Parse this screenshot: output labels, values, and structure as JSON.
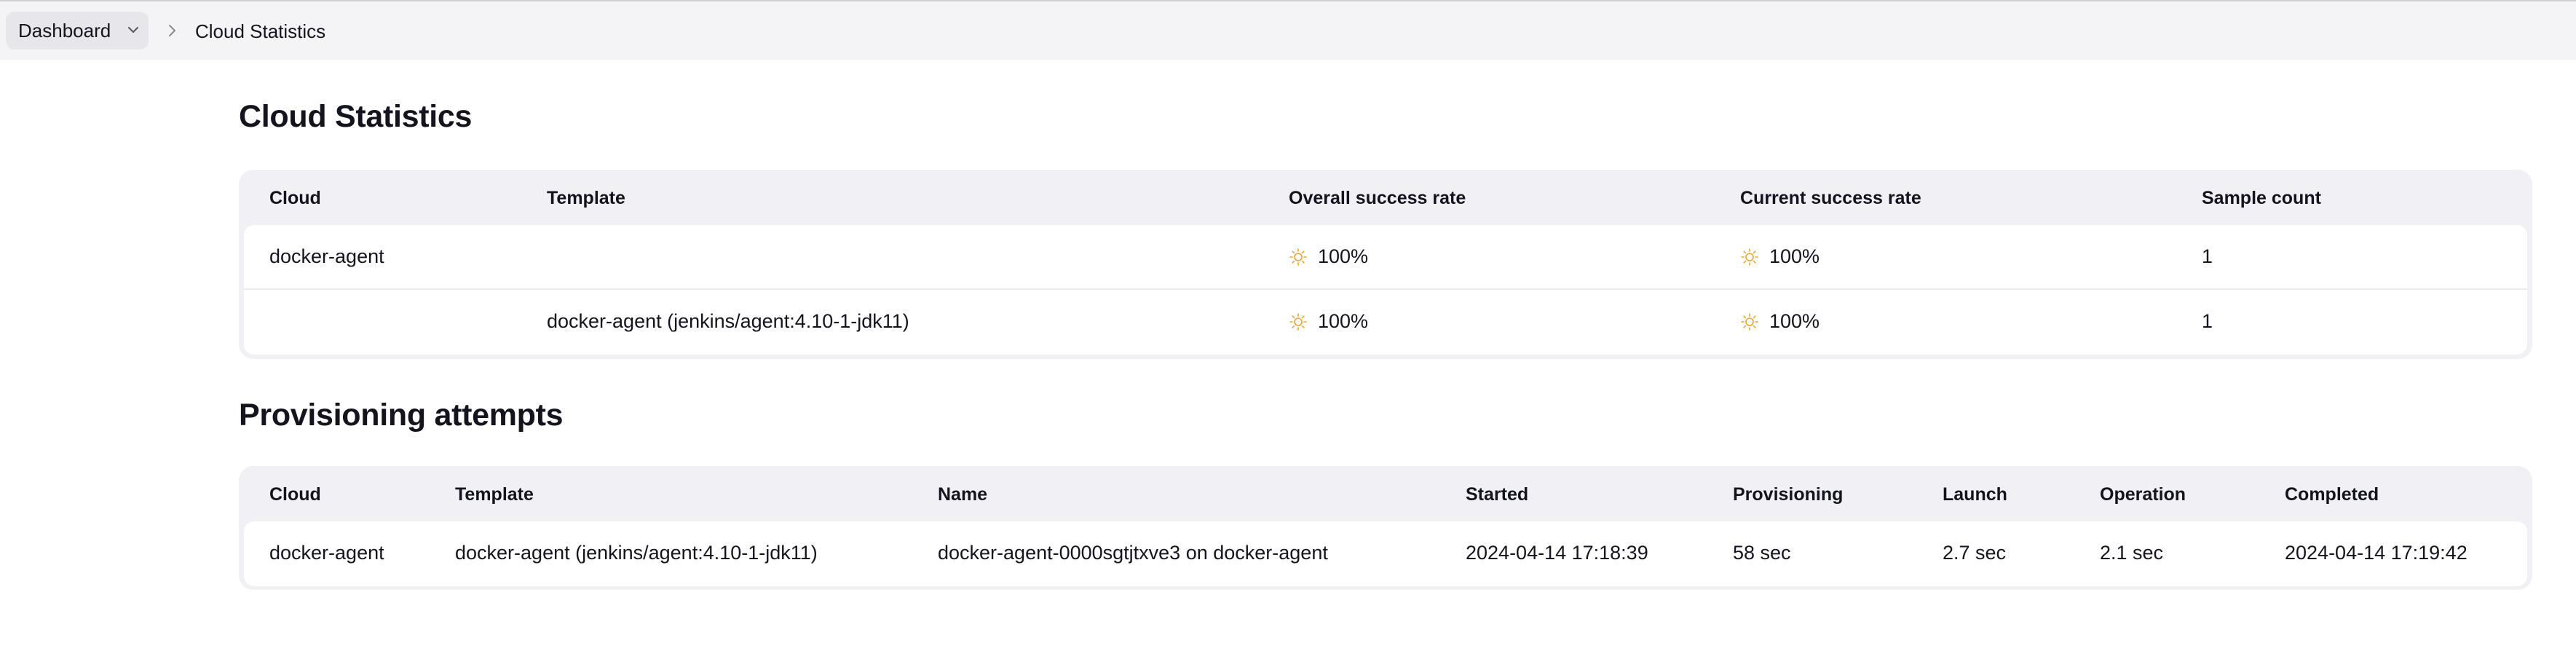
{
  "breadcrumb": {
    "root_label": "Dashboard",
    "current_label": "Cloud Statistics"
  },
  "cloud_statistics": {
    "title": "Cloud Statistics",
    "headers": [
      "Cloud",
      "Template",
      "Overall success rate",
      "Current success rate",
      "Sample count"
    ],
    "rows": [
      {
        "cloud": "docker-agent",
        "template": "",
        "overall": "100%",
        "current": "100%",
        "count": "1"
      },
      {
        "cloud": "",
        "template": "docker-agent (jenkins/agent:4.10-1-jdk11)",
        "overall": "100%",
        "current": "100%",
        "count": "1"
      }
    ]
  },
  "provisioning": {
    "title": "Provisioning attempts",
    "headers": [
      "Cloud",
      "Template",
      "Name",
      "Started",
      "Provisioning",
      "Launch",
      "Operation",
      "Completed"
    ],
    "rows": [
      {
        "cloud": "docker-agent",
        "template": "docker-agent (jenkins/agent:4.10-1-jdk11)",
        "name": "docker-agent-0000sgtjtxve3 on docker-agent",
        "started": "2024-04-14 17:18:39",
        "provisioning": "58 sec",
        "launch": "2.7 sec",
        "operation": "2.1 sec",
        "completed": "2024-04-14 17:19:42"
      }
    ]
  },
  "icons": {
    "weather": "sun-icon",
    "chevron": "chevron-down-icon",
    "separator": "chevron-right-icon"
  },
  "colors": {
    "sun": "#f0a526",
    "topbar": "#f4f4f6",
    "table_bg": "#f1f1f5"
  }
}
